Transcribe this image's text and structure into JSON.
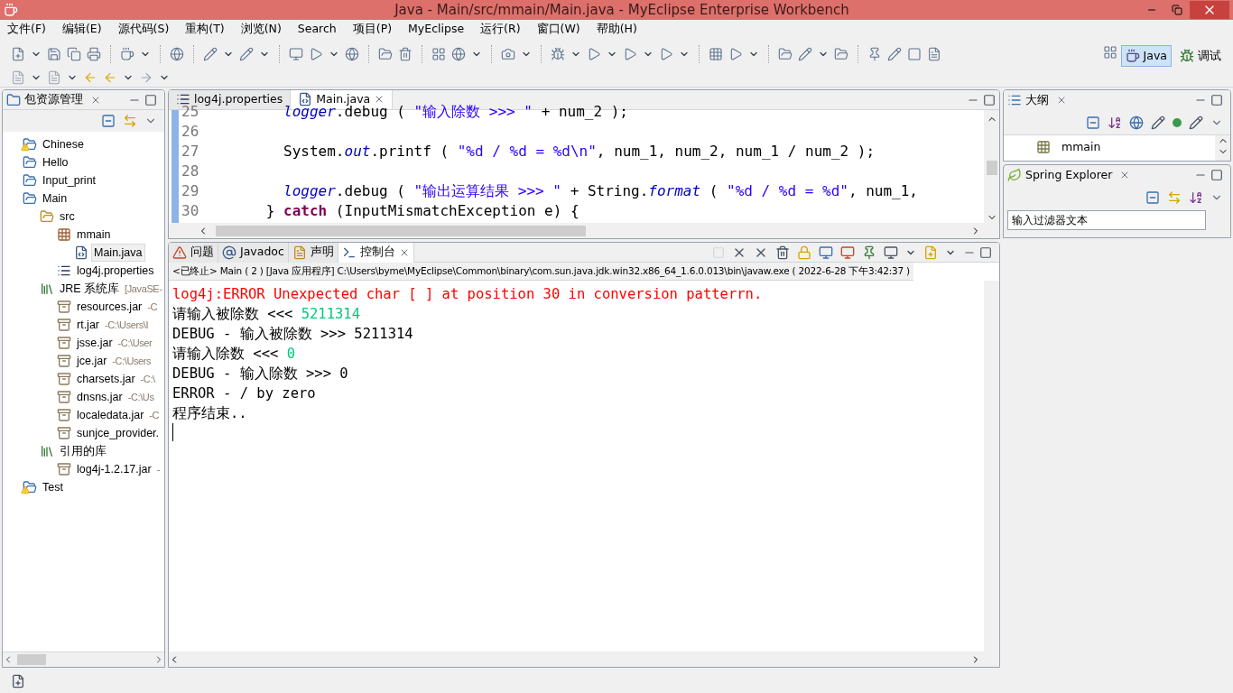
{
  "window": {
    "title": "Java  -  Main/src/mmain/Main.java  -  MyEclipse Enterprise Workbench"
  },
  "menu": [
    "文件(F)",
    "编辑(E)",
    "源代码(S)",
    "重构(T)",
    "浏览(N)",
    "Search",
    "项目(P)",
    "MyEclipse",
    "运行(R)",
    "窗口(W)",
    "帮助(H)"
  ],
  "perspectives": [
    {
      "label": "Java",
      "selected": true
    },
    {
      "label": "调试",
      "selected": false
    }
  ],
  "package_explorer": {
    "title": "包资源管理",
    "tree": [
      {
        "label": "Chinese",
        "kind": "project-warning"
      },
      {
        "label": "Hello",
        "kind": "project"
      },
      {
        "label": "Input_print",
        "kind": "project"
      },
      {
        "label": "Main",
        "kind": "project",
        "children": [
          {
            "label": "src",
            "kind": "folder",
            "children": [
              {
                "label": "mmain",
                "kind": "package",
                "children": [
                  {
                    "label": "Main.java",
                    "kind": "java",
                    "selected": true
                  }
                ]
              },
              {
                "label": "log4j.properties",
                "kind": "properties",
                "selected": false
              }
            ]
          },
          {
            "label": "JRE 系统库",
            "suffix": "[JavaSE-",
            "kind": "library",
            "children": [
              {
                "label": "resources.jar",
                "suffix": "-C",
                "kind": "jar"
              },
              {
                "label": "rt.jar",
                "suffix": "-C:\\Users\\I",
                "kind": "jar"
              },
              {
                "label": "jsse.jar",
                "suffix": "-C:\\User",
                "kind": "jar"
              },
              {
                "label": "jce.jar",
                "suffix": "-C:\\Users",
                "kind": "jar"
              },
              {
                "label": "charsets.jar",
                "suffix": "-C:\\",
                "kind": "jar"
              },
              {
                "label": "dnsns.jar",
                "suffix": "-C:\\Us",
                "kind": "jar"
              },
              {
                "label": "localedata.jar",
                "suffix": "-C",
                "kind": "jar"
              },
              {
                "label": "sunjce_provider.",
                "kind": "jar"
              }
            ]
          },
          {
            "label": "引用的库",
            "kind": "library",
            "children": [
              {
                "label": "log4j-1.2.17.jar",
                "suffix": "-",
                "kind": "jar"
              }
            ]
          }
        ]
      },
      {
        "label": "Test",
        "kind": "project-warning"
      }
    ]
  },
  "editor": {
    "tabs": [
      {
        "label": "log4j.properties",
        "selected": false
      },
      {
        "label": "Main.java",
        "selected": true
      }
    ],
    "lines": [
      {
        "number": "25",
        "segments": [
          {
            "kind": "field",
            "text": "        logger"
          },
          {
            "kind": "plain",
            "text": ".debug ( "
          },
          {
            "kind": "string",
            "text": "\"输入除数 >>> \""
          },
          {
            "kind": "plain",
            "text": " + num_2 );"
          }
        ]
      },
      {
        "number": "26"
      },
      {
        "number": "27",
        "segments": [
          {
            "kind": "plain",
            "text": "        System."
          },
          {
            "kind": "field",
            "text": "out"
          },
          {
            "kind": "plain",
            "text": ".printf ( "
          },
          {
            "kind": "string",
            "text": "\"%d / %d = %d\\n\""
          },
          {
            "kind": "plain",
            "text": ", num_1, num_2, num_1 / num_2 );"
          }
        ]
      },
      {
        "number": "28"
      },
      {
        "number": "29",
        "segments": [
          {
            "kind": "field",
            "text": "        logger"
          },
          {
            "kind": "plain",
            "text": ".debug ( "
          },
          {
            "kind": "string",
            "text": "\"输出运算结果 >>> \""
          },
          {
            "kind": "plain",
            "text": " + String."
          },
          {
            "kind": "field",
            "text": "format"
          },
          {
            "kind": "plain",
            "text": " ( "
          },
          {
            "kind": "string",
            "text": "\"%d / %d = %d\""
          },
          {
            "kind": "plain",
            "text": ", num_1,"
          }
        ]
      },
      {
        "number": "30",
        "segments": [
          {
            "kind": "plain",
            "text": "      } "
          },
          {
            "kind": "keyword",
            "text": "catch"
          },
          {
            "kind": "plain",
            "text": " (InputMismatchException e) {"
          }
        ]
      }
    ]
  },
  "outline": {
    "title": "大纲",
    "items": [
      "mmain"
    ]
  },
  "spring_explorer": {
    "title": "Spring Explorer",
    "filter_placeholder": "输入过滤器文本"
  },
  "bottom_tabs": [
    {
      "label": "问题",
      "selected": false
    },
    {
      "label": "Javadoc",
      "selected": false
    },
    {
      "label": "声明",
      "selected": false
    },
    {
      "label": "控制台",
      "selected": true
    }
  ],
  "console": {
    "header": "<已终止> Main ( 2 )  [Java 应用程序] C:\\Users\\byme\\MyEclipse\\Common\\binary\\com.sun.java.jdk.win32.x86_64_1.6.0.013\\bin\\javaw.exe ( 2022-6-28 下午3:42:37 )",
    "lines": [
      [
        {
          "kind": "error",
          "text": "log4j:ERROR Unexpected char [ ] at position 30 in conversion patterrn."
        }
      ],
      [
        {
          "kind": "plain",
          "text": "请输入被除数 <<< "
        },
        {
          "kind": "input",
          "text": "5211314"
        }
      ],
      [
        {
          "kind": "plain",
          "text": "DEBUG - 输入被除数 >>> 5211314"
        }
      ],
      [
        {
          "kind": "plain",
          "text": "请输入除数 <<< "
        },
        {
          "kind": "input",
          "text": "0"
        }
      ],
      [
        {
          "kind": "plain",
          "text": "DEBUG - 输入除数 >>> 0"
        }
      ],
      [
        {
          "kind": "plain",
          "text": "ERROR - / by zero"
        }
      ],
      [
        {
          "kind": "plain",
          "text": "程序结束.."
        }
      ]
    ]
  }
}
